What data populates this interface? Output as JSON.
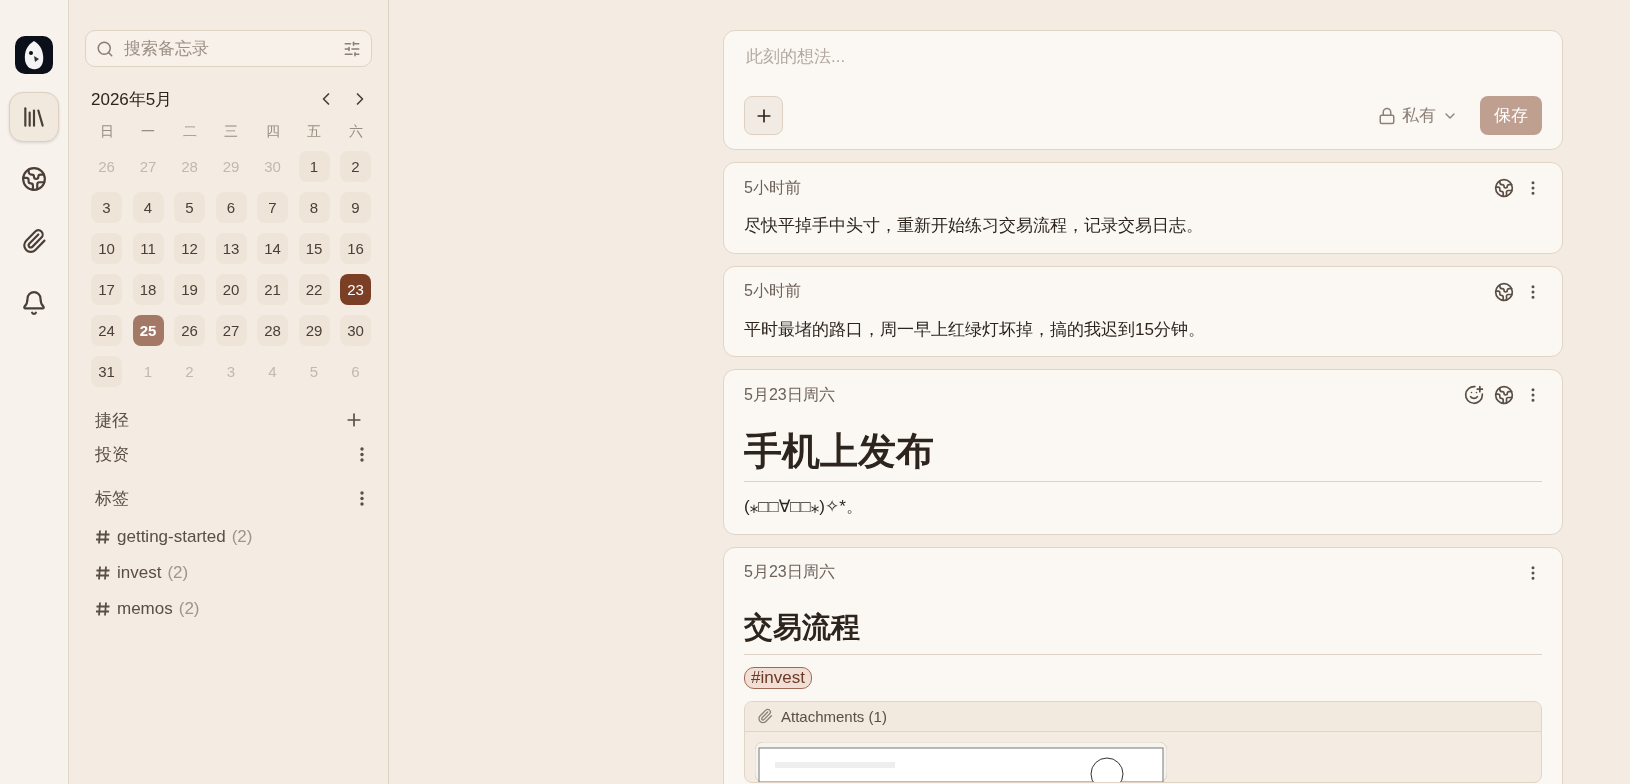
{
  "rail": {
    "items": [
      {
        "kind": "library",
        "selected": true
      },
      {
        "kind": "explore",
        "selected": false
      },
      {
        "kind": "attachments",
        "selected": false
      },
      {
        "kind": "inbox",
        "selected": false
      }
    ]
  },
  "search": {
    "placeholder": "搜索备忘录"
  },
  "calendar": {
    "title": "2026年5月",
    "weekdays": [
      "日",
      "一",
      "二",
      "三",
      "四",
      "五",
      "六"
    ],
    "days": [
      {
        "label": "26",
        "kind": "outside",
        "selected": false,
        "today": false
      },
      {
        "label": "27",
        "kind": "outside",
        "selected": false,
        "today": false
      },
      {
        "label": "28",
        "kind": "outside",
        "selected": false,
        "today": false
      },
      {
        "label": "29",
        "kind": "outside",
        "selected": false,
        "today": false
      },
      {
        "label": "30",
        "kind": "outside",
        "selected": false,
        "today": false
      },
      {
        "label": "1",
        "kind": "day",
        "selected": false,
        "today": false
      },
      {
        "label": "2",
        "kind": "day",
        "selected": false,
        "today": false
      },
      {
        "label": "3",
        "kind": "day",
        "selected": false,
        "today": false
      },
      {
        "label": "4",
        "kind": "day",
        "selected": false,
        "today": false
      },
      {
        "label": "5",
        "kind": "day",
        "selected": false,
        "today": false
      },
      {
        "label": "6",
        "kind": "day",
        "selected": false,
        "today": false
      },
      {
        "label": "7",
        "kind": "day",
        "selected": false,
        "today": false
      },
      {
        "label": "8",
        "kind": "day",
        "selected": false,
        "today": false
      },
      {
        "label": "9",
        "kind": "day",
        "selected": false,
        "today": false
      },
      {
        "label": "10",
        "kind": "day",
        "selected": false,
        "today": false
      },
      {
        "label": "11",
        "kind": "day",
        "selected": false,
        "today": false
      },
      {
        "label": "12",
        "kind": "day",
        "selected": false,
        "today": false
      },
      {
        "label": "13",
        "kind": "day",
        "selected": false,
        "today": false
      },
      {
        "label": "14",
        "kind": "day",
        "selected": false,
        "today": false
      },
      {
        "label": "15",
        "kind": "day",
        "selected": false,
        "today": false
      },
      {
        "label": "16",
        "kind": "day",
        "selected": false,
        "today": false
      },
      {
        "label": "17",
        "kind": "day",
        "selected": false,
        "today": false
      },
      {
        "label": "18",
        "kind": "day",
        "selected": false,
        "today": false
      },
      {
        "label": "19",
        "kind": "day",
        "selected": false,
        "today": false
      },
      {
        "label": "20",
        "kind": "day",
        "selected": false,
        "today": false
      },
      {
        "label": "21",
        "kind": "day",
        "selected": false,
        "today": false
      },
      {
        "label": "22",
        "kind": "day",
        "selected": false,
        "today": false
      },
      {
        "label": "23",
        "kind": "day",
        "selected": true,
        "today": false
      },
      {
        "label": "24",
        "kind": "day",
        "selected": false,
        "today": false
      },
      {
        "label": "25",
        "kind": "day",
        "selected": false,
        "today": true
      },
      {
        "label": "26",
        "kind": "day",
        "selected": false,
        "today": false
      },
      {
        "label": "27",
        "kind": "day",
        "selected": false,
        "today": false
      },
      {
        "label": "28",
        "kind": "day",
        "selected": false,
        "today": false
      },
      {
        "label": "29",
        "kind": "day",
        "selected": false,
        "today": false
      },
      {
        "label": "30",
        "kind": "day",
        "selected": false,
        "today": false
      },
      {
        "label": "31",
        "kind": "day",
        "selected": false,
        "today": false
      },
      {
        "label": "1",
        "kind": "outside",
        "selected": false,
        "today": false
      },
      {
        "label": "2",
        "kind": "outside",
        "selected": false,
        "today": false
      },
      {
        "label": "3",
        "kind": "outside",
        "selected": false,
        "today": false
      },
      {
        "label": "4",
        "kind": "outside",
        "selected": false,
        "today": false
      },
      {
        "label": "5",
        "kind": "outside",
        "selected": false,
        "today": false
      },
      {
        "label": "6",
        "kind": "outside",
        "selected": false,
        "today": false
      }
    ]
  },
  "shortcuts": {
    "title": "捷径",
    "items": [
      "投资"
    ]
  },
  "tags": {
    "title": "标签",
    "items": [
      {
        "name": "getting-started",
        "count": "(2)"
      },
      {
        "name": "invest",
        "count": "(2)"
      },
      {
        "name": "memos",
        "count": "(2)"
      }
    ]
  },
  "editor": {
    "placeholder": "此刻的想法...",
    "visibility": "私有",
    "save": "保存"
  },
  "memos": [
    {
      "time": "5小时前",
      "emoji_button": false,
      "shared": true,
      "blocks": [
        {
          "kind": "paragraph",
          "text": "尽快平掉手中头寸，重新开始练习交易流程，记录交易日志。"
        }
      ]
    },
    {
      "time": "5小时前",
      "emoji_button": false,
      "shared": true,
      "blocks": [
        {
          "kind": "paragraph",
          "text": "平时最堵的路口，周一早上红绿灯坏掉，搞的我迟到15分钟。"
        }
      ]
    },
    {
      "time": "5月23日周六",
      "emoji_button": true,
      "shared": true,
      "blocks": [
        {
          "kind": "heading1",
          "text": "手机上发布"
        },
        {
          "kind": "paragraph",
          "text": "(⁎□□∀□□⁎)✧*。"
        }
      ]
    },
    {
      "time": "5月23日周六",
      "emoji_button": false,
      "shared": false,
      "blocks": [
        {
          "kind": "heading2",
          "text": "交易流程"
        },
        {
          "kind": "tag",
          "text": "#invest"
        },
        {
          "kind": "attachments",
          "text": "Attachments (1)"
        }
      ]
    }
  ]
}
